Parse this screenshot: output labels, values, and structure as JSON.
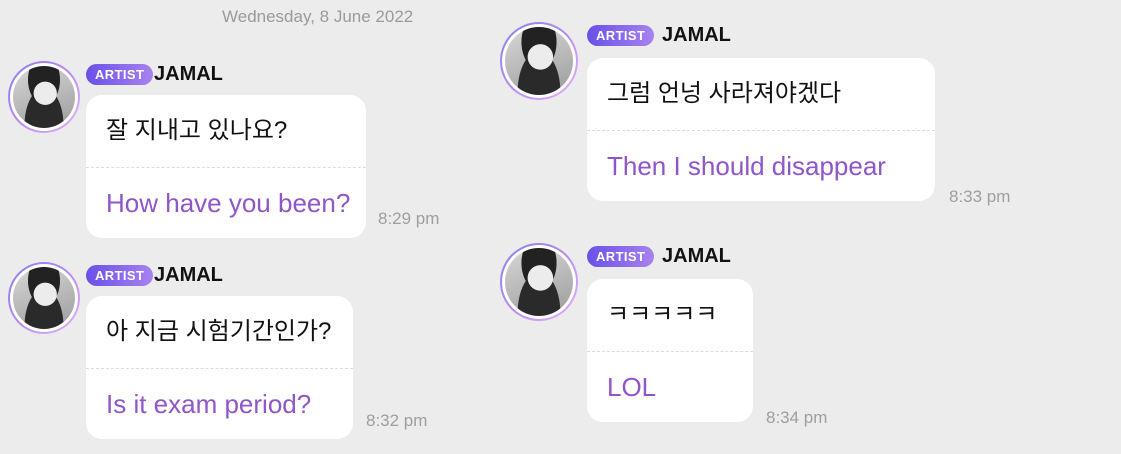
{
  "chat": {
    "date": "Wednesday, 8 June 2022",
    "messages": [
      {
        "badge": "ARTIST",
        "sender": "JAMAL",
        "korean": "잘 지내고 있나요?",
        "translation": "How have you been?",
        "time": "8:29 pm"
      },
      {
        "badge": "ARTIST",
        "sender": "JAMAL",
        "korean": "아 지금 시험기간인가?",
        "translation": "Is it exam period?",
        "time": "8:32 pm"
      },
      {
        "badge": "ARTIST",
        "sender": "JAMAL",
        "korean": "그럼 언넝 사라져야겠다",
        "translation": "Then I should disappear",
        "time": "8:33 pm"
      },
      {
        "badge": "ARTIST",
        "sender": "JAMAL",
        "korean": "ㅋㅋㅋㅋㅋ",
        "translation": "LOL",
        "time": "8:34 pm"
      }
    ]
  },
  "colors": {
    "background": "#ececec",
    "translation_text": "#8f55c9",
    "badge_gradient_start": "#6a50e8",
    "badge_gradient_end": "#a782f0"
  },
  "icons": {
    "avatar": "artist-avatar-photo"
  }
}
